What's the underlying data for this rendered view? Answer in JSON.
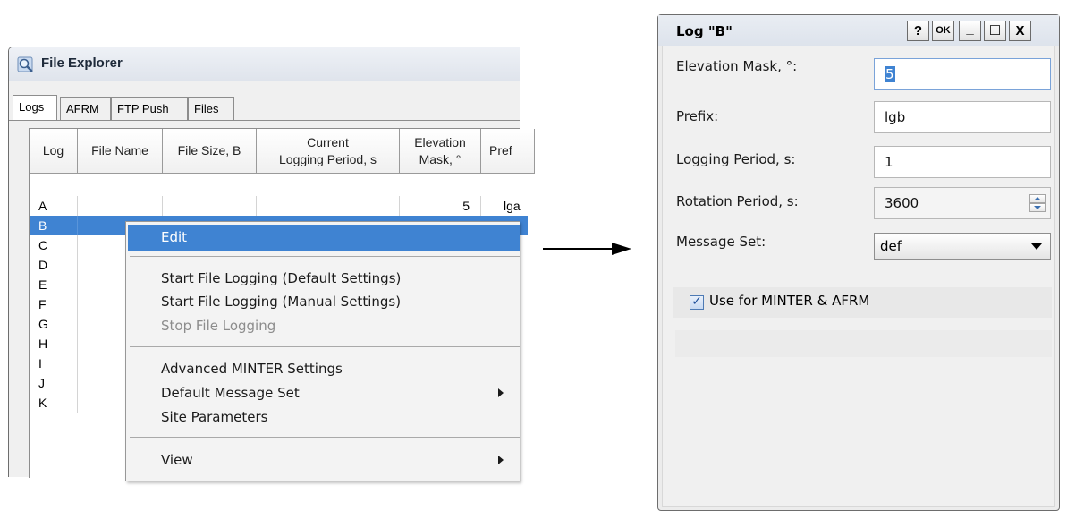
{
  "file_explorer": {
    "title": "File Explorer",
    "tabs": [
      "Logs",
      "AFRM",
      "FTP Push",
      "Files"
    ],
    "active_tab": "Logs",
    "columns": [
      "Log",
      "File Name",
      "File Size, B",
      "Current\nLogging Period, s",
      "Elevation\nMask, °",
      "Pref"
    ],
    "rows": [
      {
        "log": "A",
        "elevation_mask": "5",
        "prefix": "lga"
      },
      {
        "log": "B"
      },
      {
        "log": "C"
      },
      {
        "log": "D"
      },
      {
        "log": "E"
      },
      {
        "log": "F"
      },
      {
        "log": "G"
      },
      {
        "log": "H"
      },
      {
        "log": "I"
      },
      {
        "log": "J"
      },
      {
        "log": "K"
      }
    ],
    "selected_row": "B",
    "context_menu": {
      "edit": "Edit",
      "start_default": "Start File Logging (Default Settings)",
      "start_manual": "Start File Logging (Manual Settings)",
      "stop": "Stop File Logging",
      "advanced_minter": "Advanced MINTER Settings",
      "default_message_set": "Default Message Set",
      "site_parameters": "Site Parameters",
      "view": "View"
    }
  },
  "dialog": {
    "title": "Log \"B\"",
    "buttons": {
      "help": "?",
      "ok": "OK",
      "minimize": "_",
      "maximize": "☐",
      "close": "X"
    },
    "fields": {
      "elevation_mask_label": "Elevation Mask, °:",
      "elevation_mask_value": "5",
      "prefix_label": "Prefix:",
      "prefix_value": "lgb",
      "logging_period_label": "Logging Period, s:",
      "logging_period_value": "1",
      "rotation_period_label": "Rotation Period, s:",
      "rotation_period_value": "3600",
      "message_set_label": "Message Set:",
      "message_set_value": "def"
    },
    "checkbox_label": "Use for MINTER & AFRM",
    "checkbox_checked": true
  },
  "icons": {
    "explorer_icon": "magnifier-icon",
    "arrow": "right-arrow"
  },
  "colors": {
    "selection": "#3f83d2"
  }
}
